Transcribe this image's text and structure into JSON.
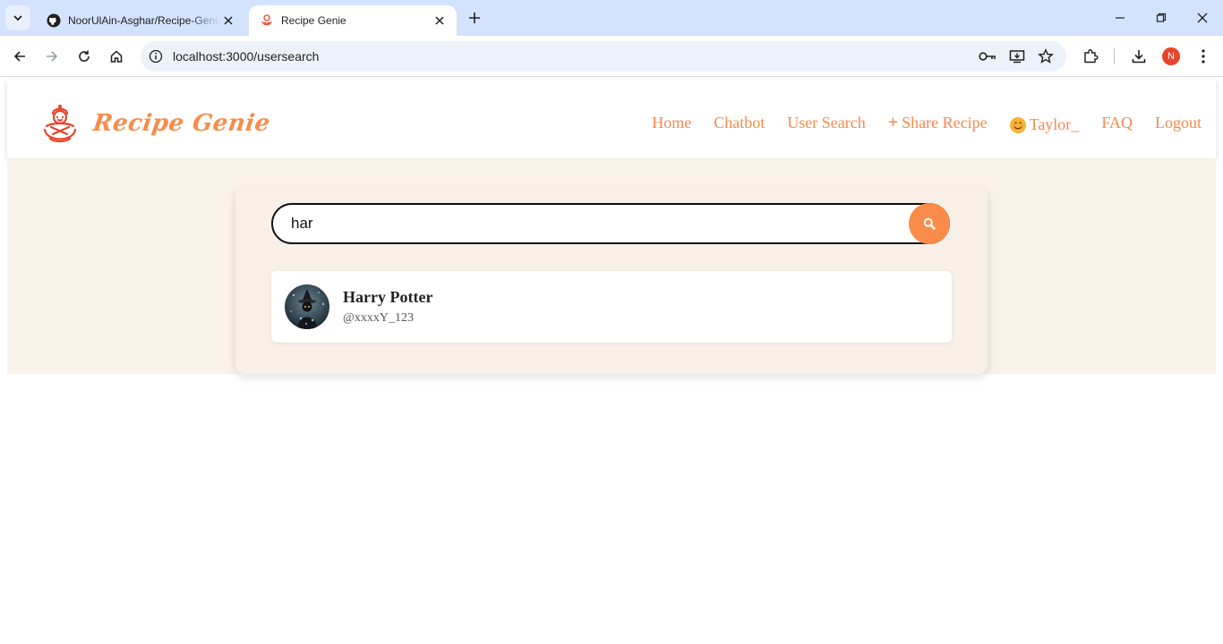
{
  "browser": {
    "tabs": [
      {
        "title": "NoorUlAin-Asghar/Recipe-Genie",
        "active": false,
        "icon": "github-icon"
      },
      {
        "title": "Recipe Genie",
        "active": true,
        "icon": "recipe-genie-icon"
      }
    ],
    "url": "localhost:3000/usersearch",
    "profile_initial": "N",
    "profile_color": "#e8442a"
  },
  "navbar": {
    "brand": "Recipe Genie",
    "links": {
      "home": "Home",
      "chatbot": "Chatbot",
      "user_search": "User Search",
      "share_recipe": "Share Recipe",
      "user": "Taylor_",
      "faq": "FAQ",
      "logout": "Logout"
    }
  },
  "search": {
    "value": "har"
  },
  "results": [
    {
      "name": "Harry Potter",
      "handle": "@xxxxY_123"
    }
  ],
  "colors": {
    "accent": "#f98c4a",
    "band": "#f8f2ea"
  }
}
